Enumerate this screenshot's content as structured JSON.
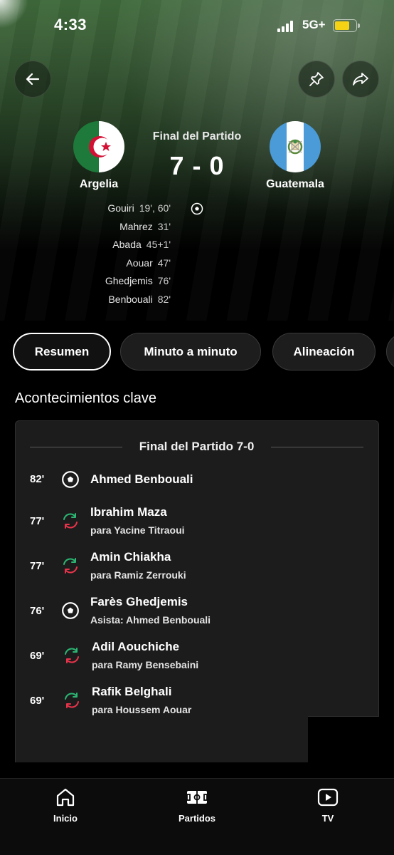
{
  "status_bar": {
    "time": "4:33",
    "network": "5G+",
    "battery_color": "#f5d214"
  },
  "header": {
    "back_icon": "arrow-left-icon",
    "pin_icon": "pin-icon",
    "share_icon": "share-icon"
  },
  "match": {
    "status": "Final del Partido",
    "score": "7 - 0",
    "home": {
      "name": "Argelia",
      "flag": "algeria-flag-icon"
    },
    "away": {
      "name": "Guatemala",
      "flag": "guatemala-flag-icon"
    },
    "scorers": [
      {
        "name": "Gouiri",
        "minutes": "19', 60'"
      },
      {
        "name": "Mahrez",
        "minutes": "31'"
      },
      {
        "name": "Abada",
        "minutes": "45+1'"
      },
      {
        "name": "Aouar",
        "minutes": "47'"
      },
      {
        "name": "Ghedjemis",
        "minutes": "76'"
      },
      {
        "name": "Benbouali",
        "minutes": "82'"
      }
    ]
  },
  "tabs": [
    {
      "label": "Resumen",
      "active": true
    },
    {
      "label": "Minuto a minuto",
      "active": false
    },
    {
      "label": "Alineación",
      "active": false
    }
  ],
  "key_events": {
    "title": "Acontecimientos clave",
    "header": "Final del Partido 7-0",
    "events": [
      {
        "minute": "82'",
        "type": "goal",
        "icon": "soccer-ball-icon",
        "player": "Ahmed Benbouali",
        "detail": ""
      },
      {
        "minute": "77'",
        "type": "substitution",
        "icon": "substitution-icon",
        "player": "Ibrahim Maza",
        "detail": "para Yacine Titraoui"
      },
      {
        "minute": "77'",
        "type": "substitution",
        "icon": "substitution-icon",
        "player": "Amin Chiakha",
        "detail": "para Ramiz Zerrouki"
      },
      {
        "minute": "76'",
        "type": "goal",
        "icon": "soccer-ball-icon",
        "player": "Farès Ghedjemis",
        "detail": "Asista: Ahmed Benbouali"
      },
      {
        "minute": "69'",
        "type": "substitution",
        "icon": "substitution-icon",
        "player": "Adil Aouchiche",
        "detail": "para Ramy Bensebaini"
      },
      {
        "minute": "69'",
        "type": "substitution",
        "icon": "substitution-icon",
        "player": "Rafik Belghali",
        "detail": "para Houssem Aouar"
      }
    ]
  },
  "bottom_nav": {
    "items": [
      {
        "label": "Inicio",
        "icon": "home-icon"
      },
      {
        "label": "Partidos",
        "icon": "pitch-icon"
      },
      {
        "label": "TV",
        "icon": "tv-play-icon"
      }
    ]
  },
  "colors": {
    "sub_in": "#2bb673",
    "sub_out": "#e8334a",
    "card_bg": "#1c1c1c"
  }
}
